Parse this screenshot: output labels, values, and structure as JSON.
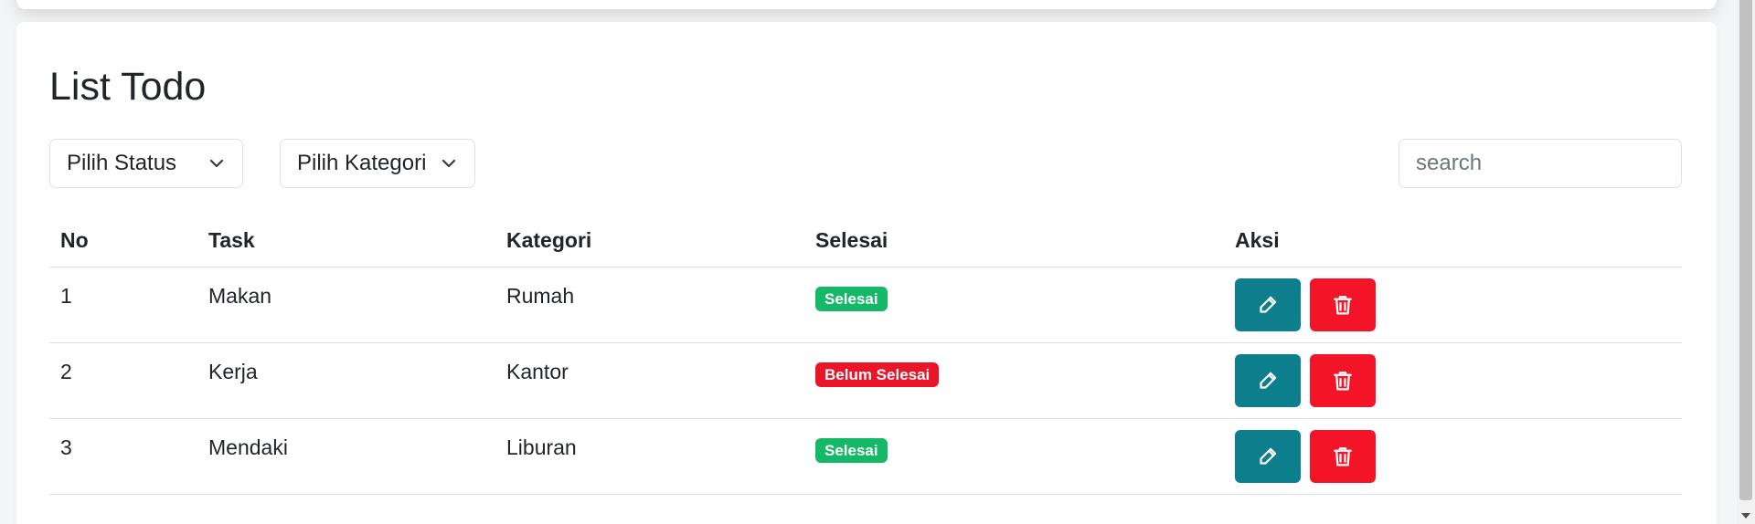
{
  "page": {
    "title": "List Todo"
  },
  "filters": {
    "status_label": "Pilih Status",
    "kategori_label": "Pilih Kategori",
    "search_placeholder": "search"
  },
  "table": {
    "headers": [
      "No",
      "Task",
      "Kategori",
      "Selesai",
      "Aksi"
    ],
    "rows": [
      {
        "no": "1",
        "task": "Makan",
        "kategori": "Rumah",
        "status": "Selesai",
        "done": true
      },
      {
        "no": "2",
        "task": "Kerja",
        "kategori": "Kantor",
        "status": "Belum Selesai",
        "done": false
      },
      {
        "no": "3",
        "task": "Mendaki",
        "kategori": "Liburan",
        "status": "Selesai",
        "done": true
      }
    ]
  },
  "icons": {
    "edit": "pencil-square-icon",
    "delete": "trash-icon",
    "dropdown": "chevron-down-icon"
  },
  "colors": {
    "badge_done": "#14b866",
    "badge_not_done": "#ea1528",
    "edit_button": "#0c7e8c",
    "delete_button": "#f31428"
  }
}
